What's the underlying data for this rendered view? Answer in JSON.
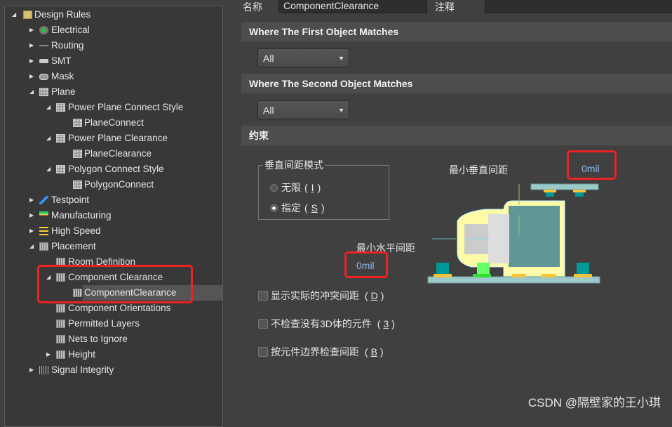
{
  "tree": [
    {
      "label": "Design Rules",
      "level": 0,
      "arrow": "expanded",
      "icon": "folder-rules-icon"
    },
    {
      "label": "Electrical",
      "level": 1,
      "arrow": "collapsed",
      "icon": "electrical-icon"
    },
    {
      "label": "Routing",
      "level": 1,
      "arrow": "collapsed",
      "icon": "routing-icon"
    },
    {
      "label": "SMT",
      "level": 1,
      "arrow": "collapsed",
      "icon": "smt-icon"
    },
    {
      "label": "Mask",
      "level": 1,
      "arrow": "collapsed",
      "icon": "mask-icon"
    },
    {
      "label": "Plane",
      "level": 1,
      "arrow": "expanded",
      "icon": "plane-icon"
    },
    {
      "label": "Power Plane Connect Style",
      "level": 2,
      "arrow": "expanded",
      "icon": "plane-icon"
    },
    {
      "label": "PlaneConnect",
      "level": 3,
      "arrow": "",
      "icon": "plane-icon"
    },
    {
      "label": "Power Plane Clearance",
      "level": 2,
      "arrow": "expanded",
      "icon": "plane-icon"
    },
    {
      "label": "PlaneClearance",
      "level": 3,
      "arrow": "",
      "icon": "plane-icon"
    },
    {
      "label": "Polygon Connect Style",
      "level": 2,
      "arrow": "expanded",
      "icon": "plane-icon"
    },
    {
      "label": "PolygonConnect",
      "level": 3,
      "arrow": "",
      "icon": "plane-icon"
    },
    {
      "label": "Testpoint",
      "level": 1,
      "arrow": "collapsed",
      "icon": "testpoint-icon"
    },
    {
      "label": "Manufacturing",
      "level": 1,
      "arrow": "collapsed",
      "icon": "manufacturing-icon"
    },
    {
      "label": "High Speed",
      "level": 1,
      "arrow": "collapsed",
      "icon": "high-speed-icon"
    },
    {
      "label": "Placement",
      "level": 1,
      "arrow": "expanded",
      "icon": "chip-icon"
    },
    {
      "label": "Room Definition",
      "level": 2,
      "arrow": "",
      "icon": "chip-icon"
    },
    {
      "label": "Component Clearance",
      "level": 2,
      "arrow": "expanded",
      "icon": "chip-icon"
    },
    {
      "label": "ComponentClearance",
      "level": 3,
      "arrow": "",
      "icon": "chip-icon",
      "selected": true
    },
    {
      "label": "Component Orientations",
      "level": 2,
      "arrow": "",
      "icon": "chip-icon"
    },
    {
      "label": "Permitted Layers",
      "level": 2,
      "arrow": "",
      "icon": "chip-icon"
    },
    {
      "label": "Nets to Ignore",
      "level": 2,
      "arrow": "",
      "icon": "chip-icon"
    },
    {
      "label": "Height",
      "level": 2,
      "arrow": "collapsed",
      "icon": "chip-icon"
    },
    {
      "label": "Signal Integrity",
      "level": 1,
      "arrow": "collapsed",
      "icon": "signal-integrity-icon"
    }
  ],
  "main": {
    "name_label": "名称",
    "name_value": "ComponentClearance",
    "comment_label": "注释",
    "comment_value": "",
    "first_header": "Where The First Object Matches",
    "first_value": "All",
    "second_header": "Where The Second Object Matches",
    "second_value": "All",
    "constraints_header": "约束",
    "mode_group": "垂直间距模式",
    "radio_infinite": "无限",
    "radio_infinite_key": "I",
    "radio_specified": "指定",
    "radio_specified_key": "S",
    "selected_mode": "specified",
    "min_vertical_label": "最小垂直间距",
    "min_vertical_value": "0mil",
    "min_horizontal_label": "最小水平间距",
    "min_horizontal_value": "0mil",
    "check1": "显示实际的冲突间距",
    "check1_key": "D",
    "check2": "不检查没有3D体的元件",
    "check2_key": "3",
    "check3": "按元件边界检查间距",
    "check3_key": "B"
  },
  "watermark": "CSDN @隔壁家的王小琪",
  "colors": {
    "highlight": "#ee2222",
    "value_text": "#8fb8e8"
  }
}
